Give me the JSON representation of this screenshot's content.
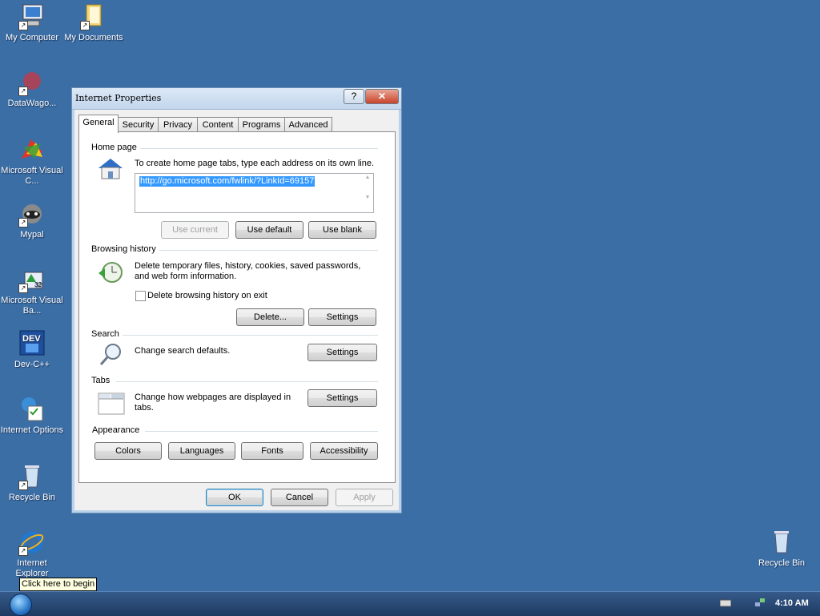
{
  "desktop": {
    "icons": [
      {
        "label": "My Computer"
      },
      {
        "label": "My Documents"
      },
      {
        "label": "DataWago..."
      },
      {
        "label": "Microsoft Visual C..."
      },
      {
        "label": "Mypal"
      },
      {
        "label": "Microsoft Visual Ba..."
      },
      {
        "label": "Dev-C++"
      },
      {
        "label": "Internet Options"
      },
      {
        "label": "Recycle Bin"
      },
      {
        "label": "Internet Explorer"
      },
      {
        "label": "Recycle Bin"
      }
    ]
  },
  "dialog": {
    "title": "Internet Properties",
    "help_glyph": "?",
    "close_glyph": "✕",
    "tabs": [
      {
        "label": "General"
      },
      {
        "label": "Security"
      },
      {
        "label": "Privacy"
      },
      {
        "label": "Content"
      },
      {
        "label": "Programs"
      },
      {
        "label": "Advanced"
      }
    ],
    "active_tab": "General",
    "home_page": {
      "section": "Home page",
      "instruction": "To create home page tabs, type each address on its own line.",
      "value": "http://go.microsoft.com/fwlink/?LinkId=69157",
      "use_current": "Use current",
      "use_default": "Use default",
      "use_blank": "Use blank"
    },
    "browsing_history": {
      "section": "Browsing history",
      "description": "Delete temporary files, history, cookies, saved passwords, and web form information.",
      "checkbox_label": "Delete browsing history on exit",
      "checked": false,
      "delete": "Delete...",
      "settings": "Settings"
    },
    "search": {
      "section": "Search",
      "description": "Change search defaults.",
      "settings": "Settings"
    },
    "tabs_section": {
      "section": "Tabs",
      "description": "Change how webpages are displayed in tabs.",
      "settings": "Settings"
    },
    "appearance": {
      "section": "Appearance",
      "colors": "Colors",
      "languages": "Languages",
      "fonts": "Fonts",
      "accessibility": "Accessibility"
    },
    "footer": {
      "ok": "OK",
      "cancel": "Cancel",
      "apply": "Apply"
    }
  },
  "taskbar": {
    "tooltip": "Click here to begin",
    "clock": "4:10 AM"
  },
  "colors": {
    "desktop": "#3a6ea5",
    "selection": "#3399ff"
  }
}
